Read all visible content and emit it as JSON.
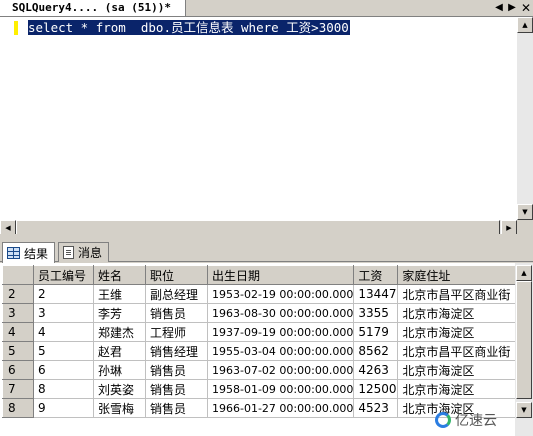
{
  "document_tab": {
    "title": "SQLQuery4....  (sa (51))*",
    "nav_left_icon": "chevron-left-icon",
    "nav_right_icon": "chevron-right-icon",
    "close_icon": "close-icon"
  },
  "editor": {
    "query": "select * from  dbo.员工信息表 where 工资>3000",
    "selection_color": "#0a246a",
    "change_marker_color": "#ffef00"
  },
  "result_tabs": [
    {
      "label": "结果",
      "icon": "grid-icon",
      "active": true
    },
    {
      "label": "消息",
      "icon": "message-icon",
      "active": false
    }
  ],
  "grid": {
    "columns": [
      "员工编号",
      "姓名",
      "职位",
      "出生日期",
      "工资",
      "家庭住址"
    ],
    "rows": [
      {
        "rownum": "2",
        "cells": [
          "2",
          "王维",
          "副总经理",
          "1953-02-19 00:00:00.000",
          "13447",
          "北京市昌平区商业街"
        ]
      },
      {
        "rownum": "3",
        "cells": [
          "3",
          "李芳",
          "销售员",
          "1963-08-30 00:00:00.000",
          "3355",
          "北京市海淀区"
        ]
      },
      {
        "rownum": "4",
        "cells": [
          "4",
          "郑建杰",
          "工程师",
          "1937-09-19 00:00:00.000",
          "5179",
          "北京市海淀区"
        ]
      },
      {
        "rownum": "5",
        "cells": [
          "5",
          "赵君",
          "销售经理",
          "1955-03-04 00:00:00.000",
          "8562",
          "北京市昌平区商业街"
        ]
      },
      {
        "rownum": "6",
        "cells": [
          "6",
          "孙琳",
          "销售员",
          "1963-07-02 00:00:00.000",
          "4263",
          "北京市海淀区"
        ]
      },
      {
        "rownum": "7",
        "cells": [
          "8",
          "刘英姿",
          "销售员",
          "1958-01-09 00:00:00.000",
          "12500",
          "北京市海淀区"
        ]
      },
      {
        "rownum": "8",
        "cells": [
          "9",
          "张雪梅",
          "销售员",
          "1966-01-27 00:00:00.000",
          "4523",
          "北京市海淀区"
        ]
      }
    ]
  },
  "watermark": {
    "text": "亿速云",
    "logo_icon": "yisu-cloud-logo"
  }
}
